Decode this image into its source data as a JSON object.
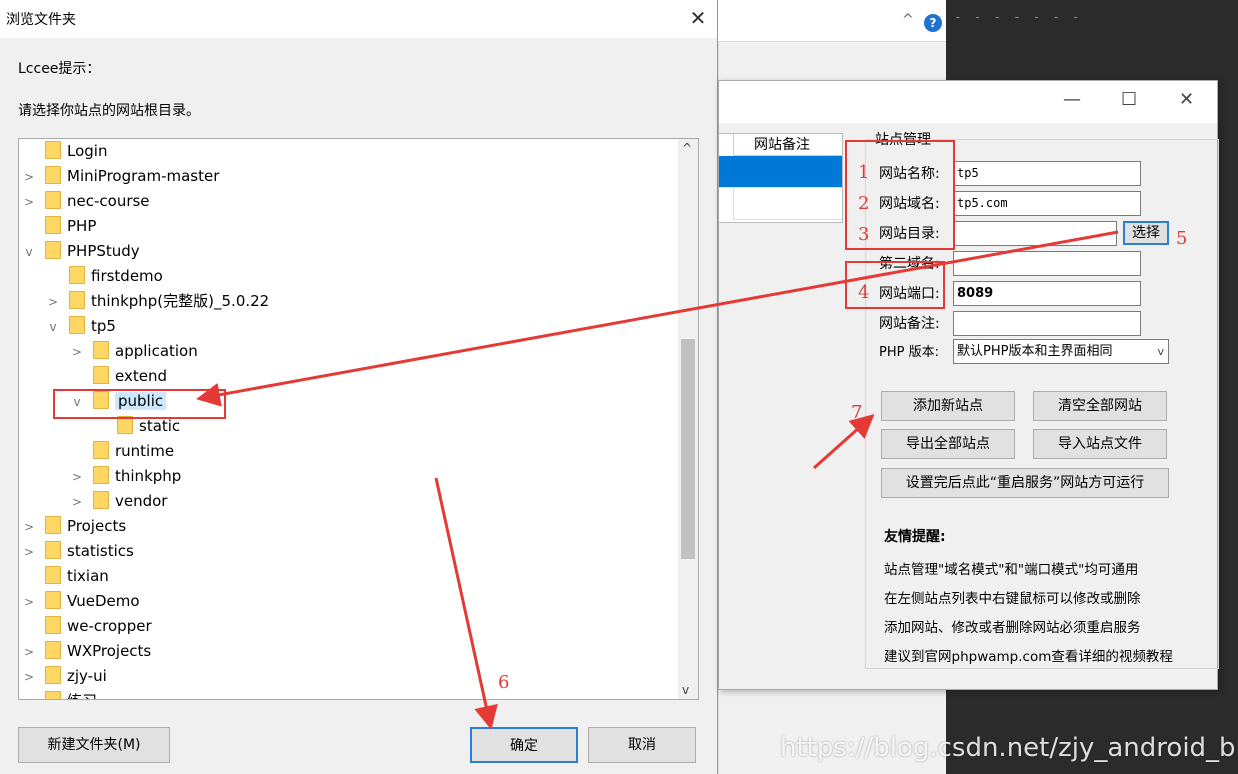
{
  "background": {
    "dash_text": "- - - - - - -",
    "chevron_glyph": "^",
    "help_glyph": "?"
  },
  "browse_dialog": {
    "title": "浏览文件夹",
    "close_glyph": "✕",
    "hint_title": "Lccee提示：",
    "hint_text": "请选择你站点的网站根目录。",
    "tree_items": [
      {
        "label": "Login",
        "arrow": ""
      },
      {
        "label": "MiniProgram-master",
        "arrow": ">"
      },
      {
        "label": "nec-course",
        "arrow": ">"
      },
      {
        "label": "PHP",
        "arrow": ""
      },
      {
        "label": "PHPStudy",
        "arrow": "v"
      },
      {
        "label": "firstdemo",
        "arrow": ""
      },
      {
        "label": "thinkphp(完整版)_5.0.22",
        "arrow": ">"
      },
      {
        "label": "tp5",
        "arrow": "v"
      },
      {
        "label": "application",
        "arrow": ">"
      },
      {
        "label": "extend",
        "arrow": ""
      },
      {
        "label": "public",
        "arrow": "v",
        "selected": true
      },
      {
        "label": "static",
        "arrow": ""
      },
      {
        "label": "runtime",
        "arrow": ""
      },
      {
        "label": "thinkphp",
        "arrow": ">"
      },
      {
        "label": "vendor",
        "arrow": ">"
      },
      {
        "label": "Projects",
        "arrow": ">"
      },
      {
        "label": "statistics",
        "arrow": ">"
      },
      {
        "label": "tixian",
        "arrow": ""
      },
      {
        "label": "VueDemo",
        "arrow": ">"
      },
      {
        "label": "we-cropper",
        "arrow": ""
      },
      {
        "label": "WXProjects",
        "arrow": ">"
      },
      {
        "label": "zjy-ui",
        "arrow": ">"
      },
      {
        "label": "练习",
        "arrow": ">"
      }
    ],
    "scroll_up_glyph": "^",
    "scroll_down_glyph": "v",
    "new_folder_label": "新建文件夹(M)",
    "ok_label": "确定",
    "cancel_label": "取消"
  },
  "site_dialog": {
    "minimize_glyph": "—",
    "maximize_glyph": "☐",
    "close_glyph": "✕",
    "list_header": "网站备注",
    "group_title": "站点管理",
    "fields": {
      "name_label": "网站名称:",
      "name_value": "tp5",
      "domain_label": "网站域名:",
      "domain_value": "tp5.com",
      "dir_label": "网站目录:",
      "dir_value": "",
      "choose_label": "选择",
      "second_domain_label": "第二域名:",
      "second_domain_value": "",
      "port_label": "网站端口:",
      "port_value": "8089",
      "remark_label": "网站备注:",
      "remark_value": "",
      "php_label": "PHP 版本:",
      "php_value": "默认PHP版本和主界面相同",
      "dropdown_glyph": "v"
    },
    "buttons": {
      "add_site": "添加新站点",
      "clear_all": "清空全部网站",
      "export_all": "导出全部站点",
      "import_file": "导入站点文件",
      "restart_hint": "设置完后点此“重启服务”网站方可运行"
    },
    "notes_title": "友情提醒:",
    "notes": [
      "站点管理\"域名模式\"和\"端口模式\"均可通用",
      "在左侧站点列表中右键鼠标可以修改或删除",
      "添加网站、修改或者删除网站必须重启服务",
      "建议到官网phpwamp.com查看详细的视频教程"
    ]
  },
  "annotations": {
    "numbers": [
      "1",
      "2",
      "3",
      "4",
      "5",
      "6",
      "7"
    ],
    "color": "#e53935"
  },
  "watermark": "https://blog.csdn.net/zjy_android_blog"
}
